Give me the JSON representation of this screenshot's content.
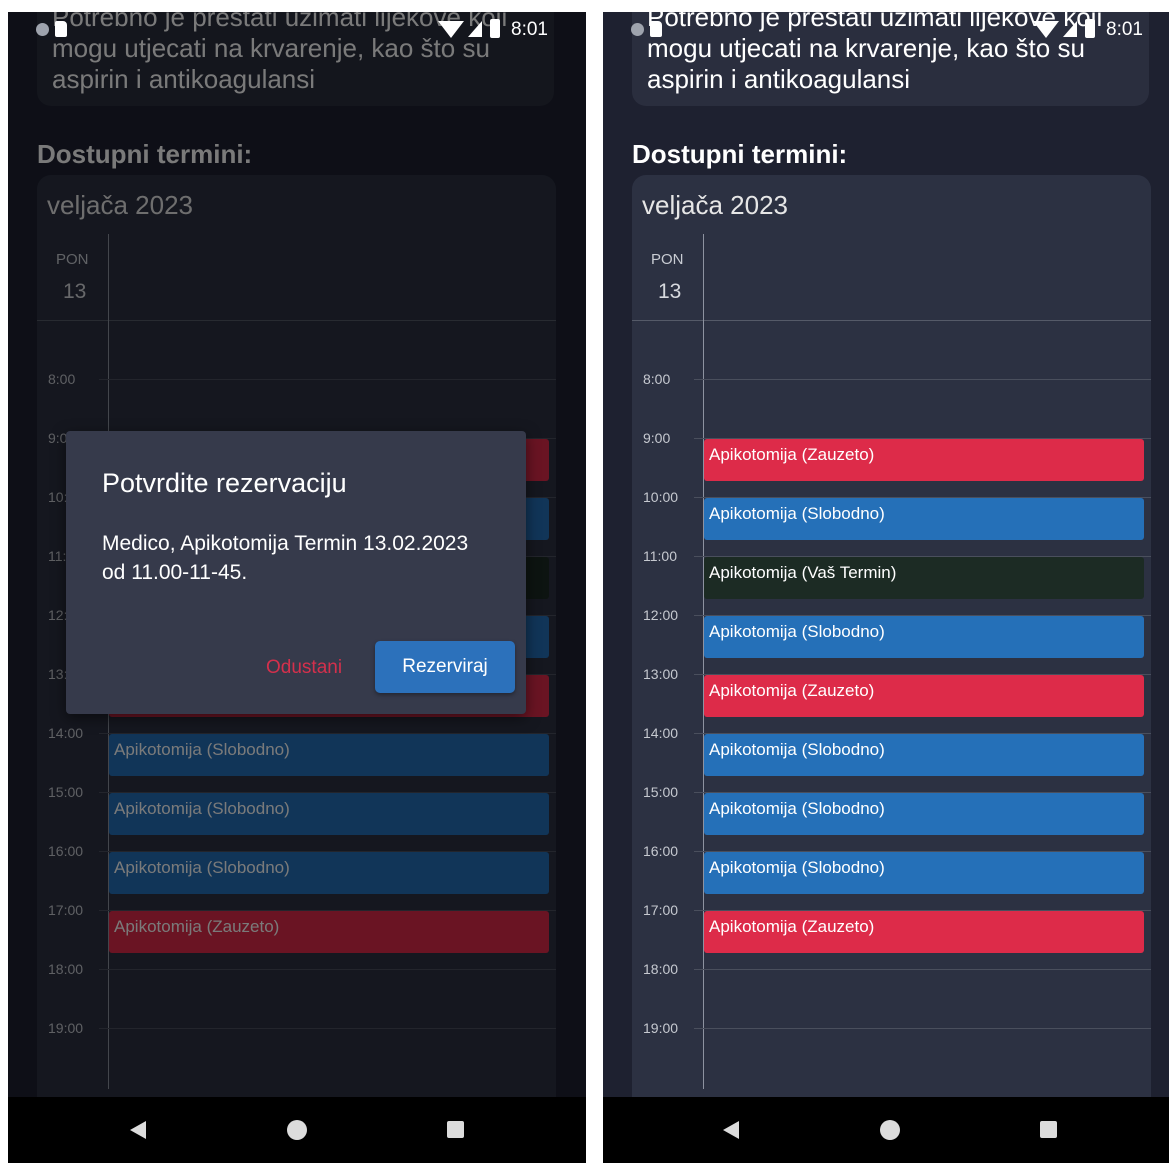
{
  "status": {
    "time": "8:01"
  },
  "info_card": {
    "text": "Potrebno je prestati uzimati lijekove koji mogu utjecati na krvarenje, kao što su aspirin i antikoagulansi"
  },
  "section_title": "Dostupni termini:",
  "calendar": {
    "month": "veljača 2023",
    "day_name": "PON",
    "day_number": "13",
    "hours": [
      "8:00",
      "9:00",
      "10:00",
      "11:00",
      "12:00",
      "13:00",
      "14:00",
      "15:00",
      "16:00",
      "17:00",
      "18:00",
      "19:00"
    ],
    "events": [
      {
        "label": "Apikotomija (Zauzeto)",
        "status": "busy"
      },
      {
        "label": "Apikotomija (Slobodno)",
        "status": "free"
      },
      {
        "label": "Apikotomija (Vaš Termin)",
        "status": "mine"
      },
      {
        "label": "Apikotomija (Slobodno)",
        "status": "free"
      },
      {
        "label": "Apikotomija (Zauzeto)",
        "status": "busy"
      },
      {
        "label": "Apikotomija (Slobodno)",
        "status": "free"
      },
      {
        "label": "Apikotomija (Slobodno)",
        "status": "free"
      },
      {
        "label": "Apikotomija (Slobodno)",
        "status": "free"
      },
      {
        "label": "Apikotomija (Zauzeto)",
        "status": "busy"
      }
    ]
  },
  "dialog": {
    "title": "Potvrdite rezervaciju",
    "body": "Medico, Apikotomija Termin 13.02.2023 od 11.00-11-45.",
    "cancel_label": "Odustani",
    "confirm_label": "Rezerviraj"
  },
  "colors": {
    "background": "#1e2130",
    "card": "#2c3142",
    "busy": "#dd2b49",
    "free": "#2570b8",
    "mine": "#1c2b24",
    "accent_button": "#2c71bb",
    "cancel_text": "#d4304c"
  },
  "icons": [
    "back-icon",
    "home-icon",
    "recent-apps-icon",
    "wifi-icon",
    "signal-icon",
    "battery-icon",
    "sd-card-icon"
  ]
}
